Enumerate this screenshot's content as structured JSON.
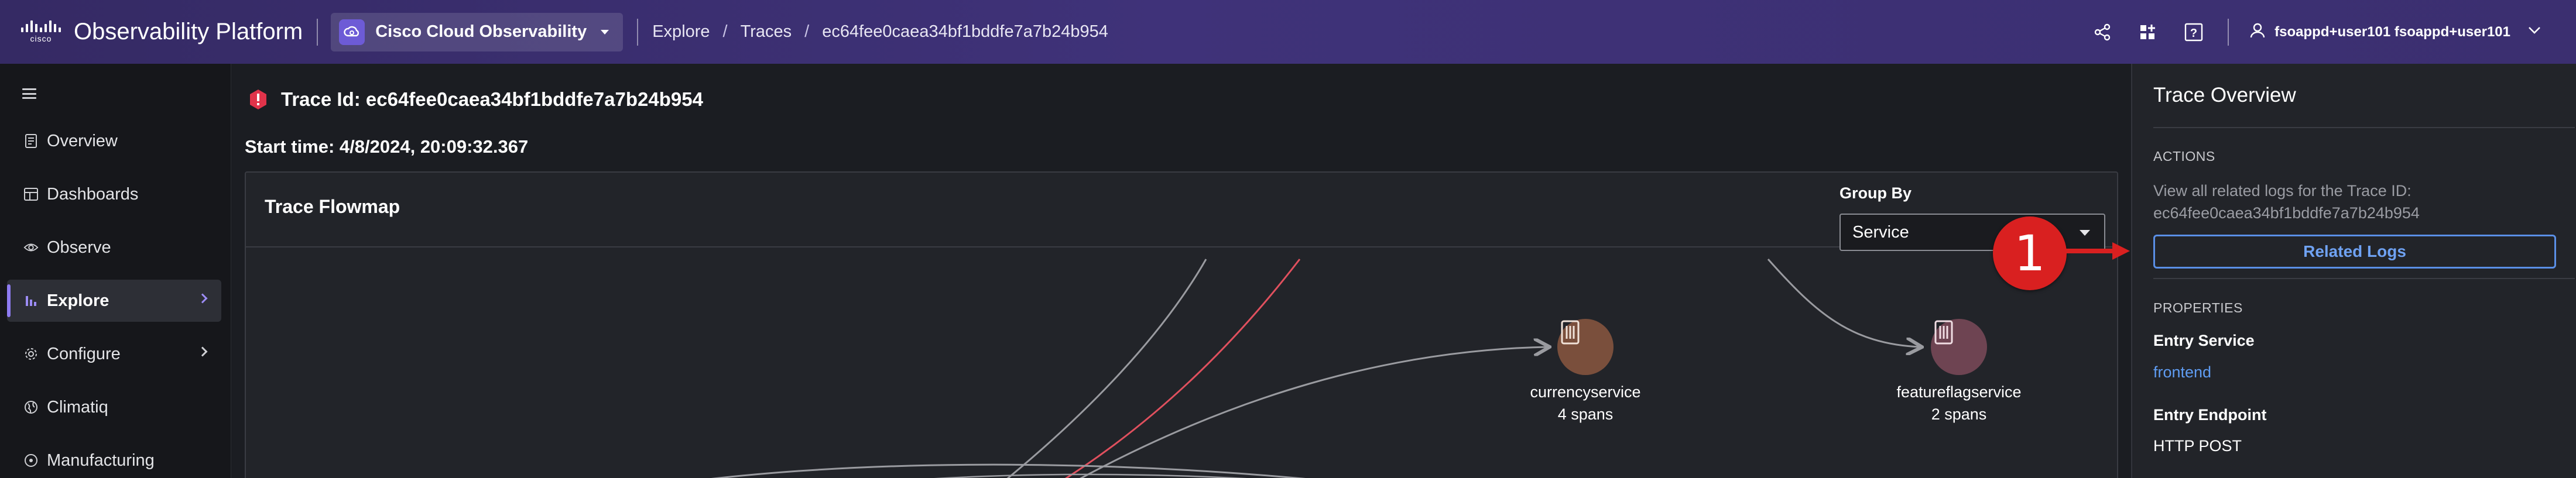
{
  "header": {
    "brand": "Observability Platform",
    "logo_text": "cisco",
    "tenant": "Cisco Cloud Observability",
    "breadcrumb": [
      "Explore",
      "Traces",
      "ec64fee0caea34bf1bddfe7a7b24b954"
    ],
    "icons": [
      "share-icon",
      "add-widget-icon",
      "help-icon",
      "user-icon",
      "chevron-down-icon"
    ],
    "user": "fsoappd+user101 fsoappd+user101"
  },
  "sidebar": {
    "items": [
      {
        "label": "Overview",
        "icon": "overview-icon"
      },
      {
        "label": "Dashboards",
        "icon": "dashboards-icon"
      },
      {
        "label": "Observe",
        "icon": "eye-icon"
      },
      {
        "label": "Explore",
        "icon": "explore-icon",
        "active": true,
        "chevron": true
      },
      {
        "label": "Configure",
        "icon": "gear-icon",
        "chevron": true
      },
      {
        "label": "Climatiq",
        "icon": "globe-icon"
      },
      {
        "label": "Manufacturing",
        "icon": "manufacturing-icon"
      }
    ]
  },
  "main": {
    "trace_id": "Trace Id: ec64fee0caea34bf1bddfe7a7b24b954",
    "start_time": "Start time: 4/8/2024, 20:09:32.367",
    "flowmap": {
      "title": "Trace Flowmap",
      "group_by_label": "Group By",
      "group_by_value": "Service",
      "nodes": [
        {
          "name": "currencyservice",
          "spans": "4 spans",
          "color": "#7a4f3c"
        },
        {
          "name": "featureflagservice",
          "spans": "2 spans",
          "color": "#6e4452"
        }
      ],
      "edge_colors": {
        "normal": "#9a9ba0",
        "error": "#e0505e"
      }
    }
  },
  "annotation": {
    "number": "1",
    "color": "#d92020"
  },
  "panel": {
    "title": "Trace Overview",
    "actions_label": "ACTIONS",
    "actions_desc_1": "View all related logs for the Trace ID:",
    "actions_desc_2": "ec64fee0caea34bf1bddfe7a7b24b954",
    "related_logs": "Related Logs",
    "properties_label": "PROPERTIES",
    "entry_service_label": "Entry Service",
    "entry_service_value": "frontend",
    "entry_endpoint_label": "Entry Endpoint",
    "entry_endpoint_value": "HTTP POST"
  }
}
